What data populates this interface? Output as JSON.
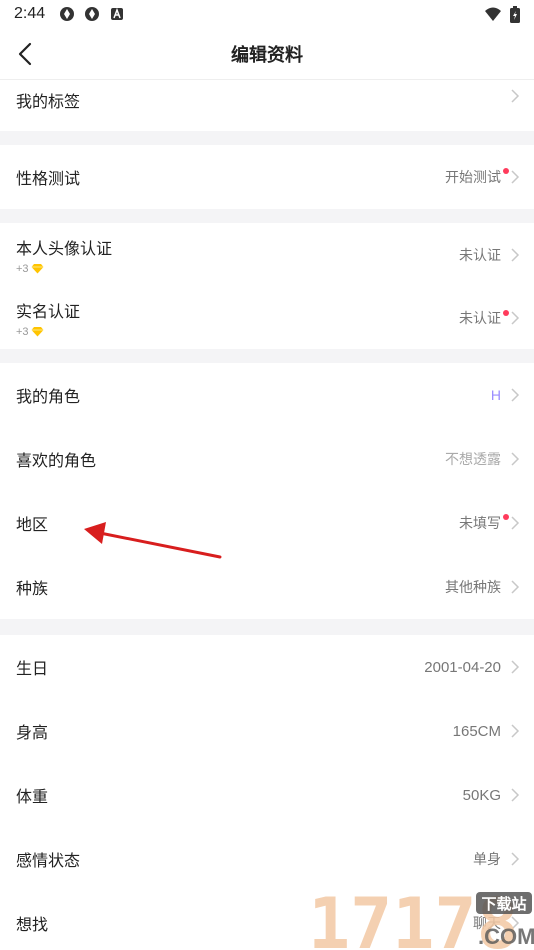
{
  "status": {
    "time": "2:44"
  },
  "header": {
    "title": "编辑资料"
  },
  "rows": {
    "tags": {
      "label": "我的标签",
      "value": ""
    },
    "personality": {
      "label": "性格测试",
      "value": "开始测试"
    },
    "avatar_verify": {
      "label": "本人头像认证",
      "reward": "+3",
      "value": "未认证"
    },
    "realname_verify": {
      "label": "实名认证",
      "reward": "+3",
      "value": "未认证"
    },
    "my_role": {
      "label": "我的角色",
      "value": "H"
    },
    "fav_role": {
      "label": "喜欢的角色",
      "value": "不想透露"
    },
    "region": {
      "label": "地区",
      "value": "未填写"
    },
    "race": {
      "label": "种族",
      "value": "其他种族"
    },
    "birthday": {
      "label": "生日",
      "value": "2001-04-20"
    },
    "height": {
      "label": "身高",
      "value": "165CM"
    },
    "weight": {
      "label": "体重",
      "value": "50KG"
    },
    "relationship": {
      "label": "感情状态",
      "value": "单身"
    },
    "looking_for": {
      "label": "想找",
      "value": "聊天"
    }
  },
  "watermark": {
    "text": "17178",
    "badge": "下载站",
    "suffix": ".COM"
  },
  "colors": {
    "accent_dot": "#ff3b5c",
    "divider": "#f4f4f6",
    "role_value": "#9a8cff",
    "annotation_arrow": "#d81e1e"
  }
}
